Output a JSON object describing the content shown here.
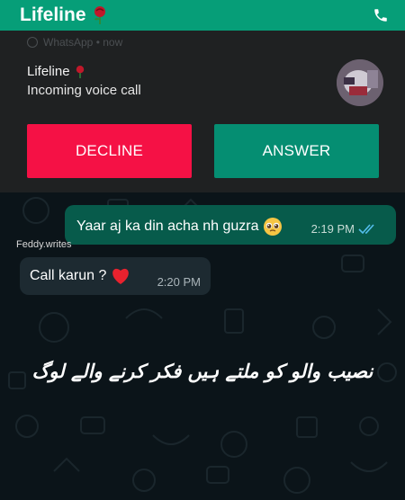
{
  "header": {
    "title": "Lifeline",
    "title_icon": "rose-icon",
    "call_icon": "phone-icon",
    "color": "#069e78"
  },
  "notification": {
    "app_line": "WhatsApp • now",
    "caller_name": "Lifeline",
    "caller_icon": "rose-icon",
    "subtitle": "Incoming voice call",
    "decline_label": "DECLINE",
    "answer_label": "ANSWER",
    "decline_color": "#f51145",
    "answer_color": "#058e72"
  },
  "chat": {
    "messages": [
      {
        "direction": "outgoing",
        "text": "Yaar aj ka din acha nh guzra",
        "emoji": "pleading-face-icon",
        "time": "2:19 PM",
        "status": "read-ticks-icon"
      },
      {
        "direction": "incoming",
        "sender": "Feddy.writes",
        "text": "Call karun ?",
        "emoji": "red-heart-icon",
        "time": "2:20 PM"
      }
    ],
    "caption": "نصیب والو کو ملتے ہیں فکر کرنے والے لوگ"
  }
}
